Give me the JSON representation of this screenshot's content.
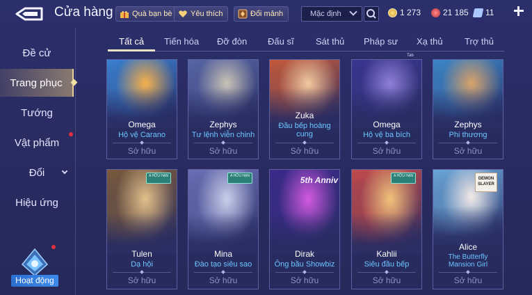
{
  "header": {
    "title": "Cửa hàng",
    "gift_label": "Quà bạn bè",
    "wishlist_label": "Yêu thích",
    "exchange_label": "Đổi mảnh",
    "sort_value": "Mặc định",
    "currencies": [
      {
        "icon": "gold-coin-icon",
        "value": "1 273"
      },
      {
        "icon": "red-gem-icon",
        "value": "21 185"
      },
      {
        "icon": "voucher-icon",
        "value": "11"
      }
    ]
  },
  "sidebar": {
    "items": [
      {
        "label": "Đề cử"
      },
      {
        "label": "Trang phục"
      },
      {
        "label": "Tướng"
      },
      {
        "label": "Vật phẩm"
      },
      {
        "label": "Đổi"
      },
      {
        "label": "Hiệu ứng"
      }
    ],
    "activity_label": "Hoạt động"
  },
  "tabs": [
    "Tất cả",
    "Tiến hóa",
    "Đỡ đòn",
    "Đấu sĩ",
    "Sát thủ",
    "Pháp sư",
    "Xạ thủ",
    "Trợ thủ"
  ],
  "tiny_tag": "Tab",
  "cards": [
    {
      "hero": "Omega",
      "skin": "Hộ vệ Carano",
      "status": "Sở hữu",
      "palette": [
        "#f6b04a",
        "#3a7fd0"
      ]
    },
    {
      "hero": "Zephys",
      "skin": "Tư lệnh viễn chinh",
      "status": "Sở hữu",
      "palette": [
        "#c9c3b6",
        "#5866a5"
      ]
    },
    {
      "hero": "Zuka",
      "skin": "Đầu bếp hoàng cung",
      "status": "Sở hữu",
      "palette": [
        "#f0c8a0",
        "#c55a3a"
      ]
    },
    {
      "hero": "Omega",
      "skin": "Hộ vệ ba bích",
      "status": "Sở hữu",
      "palette": [
        "#8f7fd8",
        "#3a3590"
      ]
    },
    {
      "hero": "Zephys",
      "skin": "Phi thương",
      "status": "Sở hữu",
      "palette": [
        "#d9a36b",
        "#3c87c8"
      ]
    },
    {
      "hero": "Tulen",
      "skin": "Dạ hội",
      "status": "Sở hữu",
      "palette": [
        "#e3c08b",
        "#7a5a3b"
      ],
      "badge": "A HỮU HẠN"
    },
    {
      "hero": "Mina",
      "skin": "Đào tạo siêu sao",
      "status": "Sở hữu",
      "palette": [
        "#c9d0ea",
        "#6a6fb5"
      ],
      "badge": "A HỮU HẠN"
    },
    {
      "hero": "Dirak",
      "skin": "Ông bầu Showbiz",
      "status": "Sở hữu",
      "palette": [
        "#d25ae0",
        "#3b2a8a"
      ],
      "anniv": "5th Anniv"
    },
    {
      "hero": "Kahlii",
      "skin": "Siêu đầu bếp",
      "status": "Sở hữu",
      "palette": [
        "#f2c37b",
        "#c24a4a"
      ],
      "badge": "A HỮU HẠN"
    },
    {
      "hero": "Alice",
      "skin": "The Butterfly Mansion Girl",
      "status": "Sở hữu",
      "palette": [
        "#f3eae7",
        "#6aa6d8"
      ],
      "corner": "DEMON SLAYER"
    }
  ]
}
